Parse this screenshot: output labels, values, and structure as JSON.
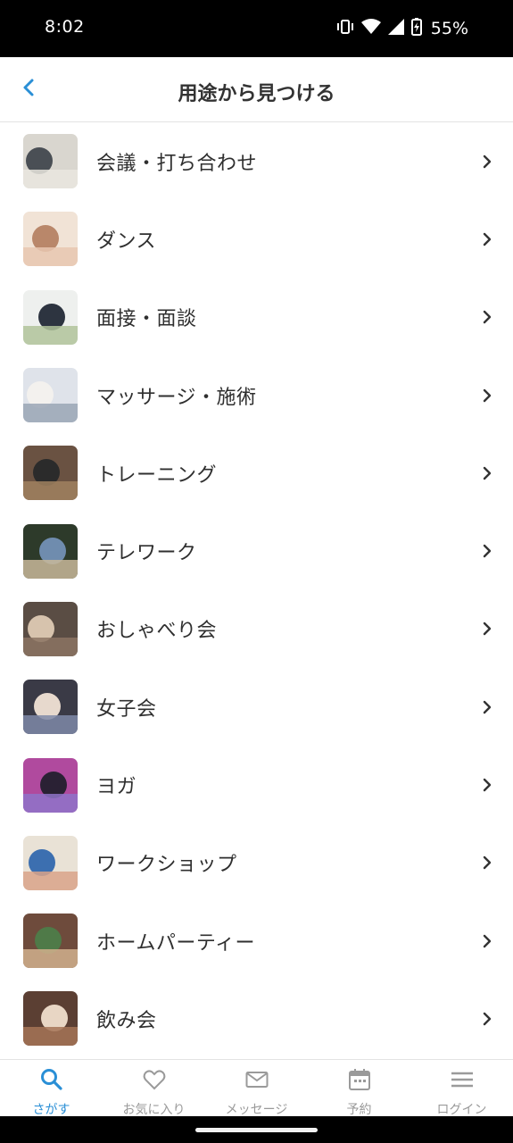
{
  "status_bar": {
    "time": "8:02",
    "battery": "55%"
  },
  "header": {
    "title": "用途から見つける"
  },
  "items": [
    {
      "label": "会議・打ち合わせ",
      "colors": [
        "#d9d6cf",
        "#4a4f55",
        "#e9e6df"
      ]
    },
    {
      "label": "ダンス",
      "colors": [
        "#f1e3d6",
        "#b9876a",
        "#e7c7b0"
      ]
    },
    {
      "label": "面接・面談",
      "colors": [
        "#eef0ee",
        "#2d3440",
        "#b0c39a"
      ]
    },
    {
      "label": "マッサージ・施術",
      "colors": [
        "#dfe3ea",
        "#f3f1ee",
        "#9aa6b5"
      ]
    },
    {
      "label": "トレーニング",
      "colors": [
        "#6a5242",
        "#2b2b2b",
        "#a0815f"
      ]
    },
    {
      "label": "テレワーク",
      "colors": [
        "#2d3a2a",
        "#6f8cae",
        "#c9b89a"
      ]
    },
    {
      "label": "おしゃべり会",
      "colors": [
        "#5a4d44",
        "#d7c3ad",
        "#8c7463"
      ]
    },
    {
      "label": "女子会",
      "colors": [
        "#3a3a46",
        "#e7d9cd",
        "#7f8aa8"
      ]
    },
    {
      "label": "ヨガ",
      "colors": [
        "#b04a9e",
        "#2a2134",
        "#8f73c9"
      ]
    },
    {
      "label": "ワークショップ",
      "colors": [
        "#e9e2d6",
        "#3c6fb0",
        "#d9a38a"
      ]
    },
    {
      "label": "ホームパーティー",
      "colors": [
        "#6e4b3c",
        "#4f7a48",
        "#d1b08d"
      ]
    },
    {
      "label": "飲み会",
      "colors": [
        "#5b3f33",
        "#e8d6c4",
        "#a67457"
      ]
    }
  ],
  "tabs": [
    {
      "label": "さがす",
      "icon": "search-icon"
    },
    {
      "label": "お気に入り",
      "icon": "heart-icon"
    },
    {
      "label": "メッセージ",
      "icon": "mail-icon"
    },
    {
      "label": "予約",
      "icon": "calendar-icon"
    },
    {
      "label": "ログイン",
      "icon": "menu-icon"
    }
  ],
  "theme": {
    "accent": "#2a8fd6",
    "inactive": "#9a9a9a"
  }
}
